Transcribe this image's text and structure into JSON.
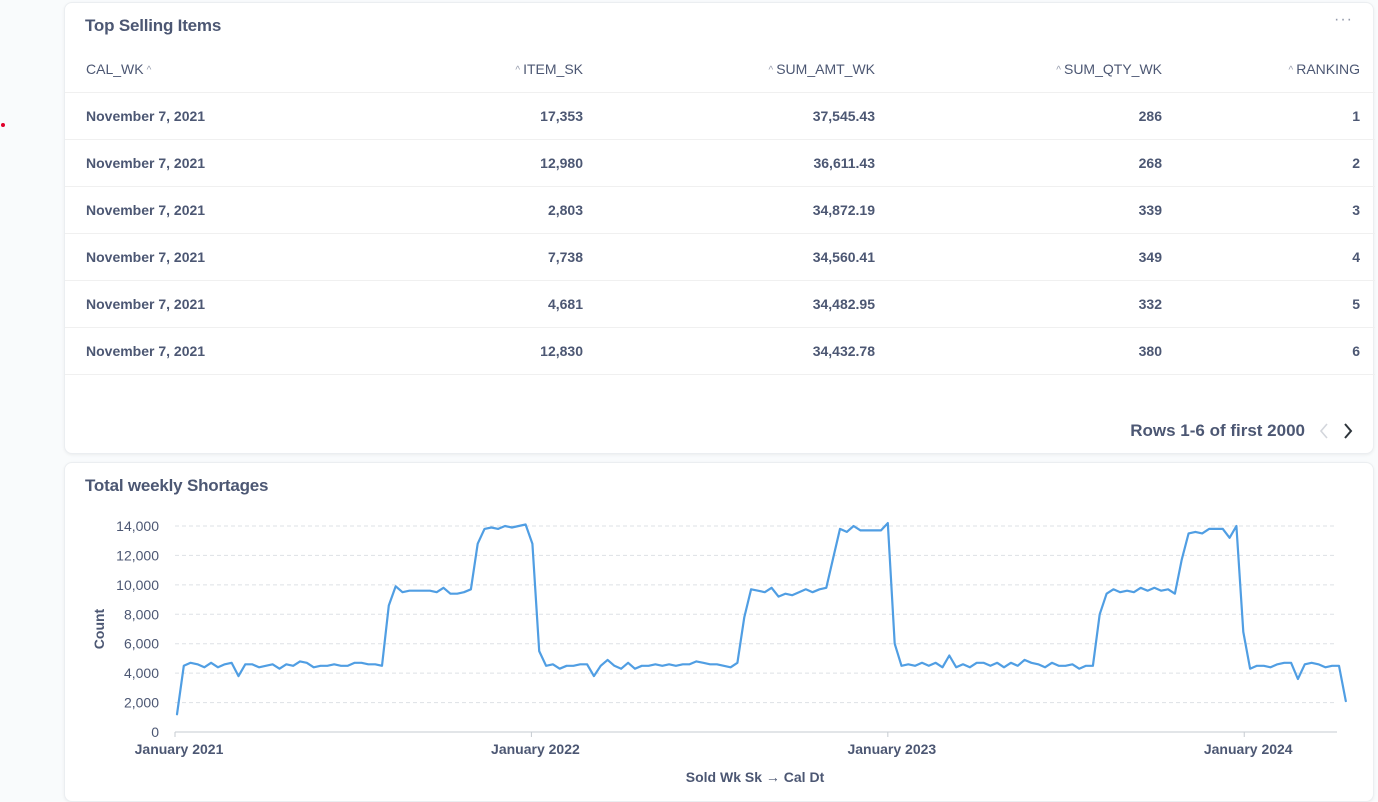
{
  "table_card": {
    "title": "Top Selling Items",
    "more_label": "···",
    "columns": [
      "CAL_WK",
      "ITEM_SK",
      "SUM_AMT_WK",
      "SUM_QTY_WK",
      "RANKING"
    ],
    "rows": [
      [
        "November 7, 2021",
        "17,353",
        "37,545.43",
        "286",
        "1"
      ],
      [
        "November 7, 2021",
        "12,980",
        "36,611.43",
        "268",
        "2"
      ],
      [
        "November 7, 2021",
        "2,803",
        "34,872.19",
        "339",
        "3"
      ],
      [
        "November 7, 2021",
        "7,738",
        "34,560.41",
        "349",
        "4"
      ],
      [
        "November 7, 2021",
        "4,681",
        "34,482.95",
        "332",
        "5"
      ],
      [
        "November 7, 2021",
        "12,830",
        "34,432.78",
        "380",
        "6"
      ]
    ],
    "pagination_label": "Rows 1-6 of first 2000"
  },
  "chart_card": {
    "title": "Total weekly Shortages"
  },
  "colors": {
    "line": "#509ee3",
    "text": "#4c5773",
    "grid": "#dde1e5"
  },
  "chart_data": {
    "type": "line",
    "title": "Total weekly Shortages",
    "xlabel": "Sold Wk Sk → Cal Dt",
    "ylabel": "Count",
    "ylim": [
      0,
      14000
    ],
    "yticks": [
      0,
      2000,
      4000,
      6000,
      8000,
      10000,
      12000,
      14000
    ],
    "ytick_labels": [
      "0",
      "2,000",
      "4,000",
      "6,000",
      "8,000",
      "10,000",
      "12,000",
      "14,000"
    ],
    "xlim": [
      "2021-01-01",
      "2024-04-05"
    ],
    "xticks": [
      "2021-01-01",
      "2022-01-01",
      "2023-01-01",
      "2024-01-01"
    ],
    "xtick_labels": [
      "January 2021",
      "January 2022",
      "January 2023",
      "January 2024"
    ],
    "grid": true,
    "x_start": "2021-01-03",
    "x_interval": "weekly",
    "values": [
      1200,
      4500,
      4700,
      4600,
      4400,
      4700,
      4400,
      4600,
      4700,
      3800,
      4600,
      4600,
      4400,
      4500,
      4600,
      4300,
      4600,
      4500,
      4800,
      4700,
      4400,
      4500,
      4500,
      4600,
      4500,
      4500,
      4700,
      4700,
      4600,
      4600,
      4500,
      8600,
      9900,
      9500,
      9600,
      9600,
      9600,
      9600,
      9500,
      9800,
      9400,
      9400,
      9500,
      9700,
      12800,
      13800,
      13900,
      13800,
      14000,
      13900,
      14000,
      14100,
      12800,
      5500,
      4500,
      4600,
      4300,
      4500,
      4500,
      4600,
      4600,
      3800,
      4500,
      4900,
      4500,
      4300,
      4700,
      4300,
      4500,
      4500,
      4600,
      4500,
      4600,
      4500,
      4600,
      4600,
      4800,
      4700,
      4600,
      4600,
      4500,
      4400,
      4700,
      7800,
      9700,
      9600,
      9500,
      9800,
      9200,
      9400,
      9300,
      9500,
      9700,
      9500,
      9700,
      9800,
      11800,
      13800,
      13600,
      14000,
      13700,
      13700,
      13700,
      13700,
      14200,
      6000,
      4500,
      4600,
      4500,
      4700,
      4500,
      4700,
      4400,
      5200,
      4400,
      4600,
      4400,
      4700,
      4700,
      4500,
      4700,
      4400,
      4700,
      4500,
      4900,
      4700,
      4600,
      4400,
      4700,
      4500,
      4500,
      4600,
      4300,
      4500,
      4500,
      8000,
      9400,
      9700,
      9500,
      9600,
      9500,
      9800,
      9600,
      9800,
      9600,
      9700,
      9400,
      11700,
      13500,
      13600,
      13500,
      13800,
      13800,
      13800,
      13200,
      14000,
      6800,
      4300,
      4500,
      4500,
      4400,
      4600,
      4700,
      4700,
      3600,
      4600,
      4700,
      4600,
      4400,
      4500,
      4500,
      2100
    ]
  }
}
